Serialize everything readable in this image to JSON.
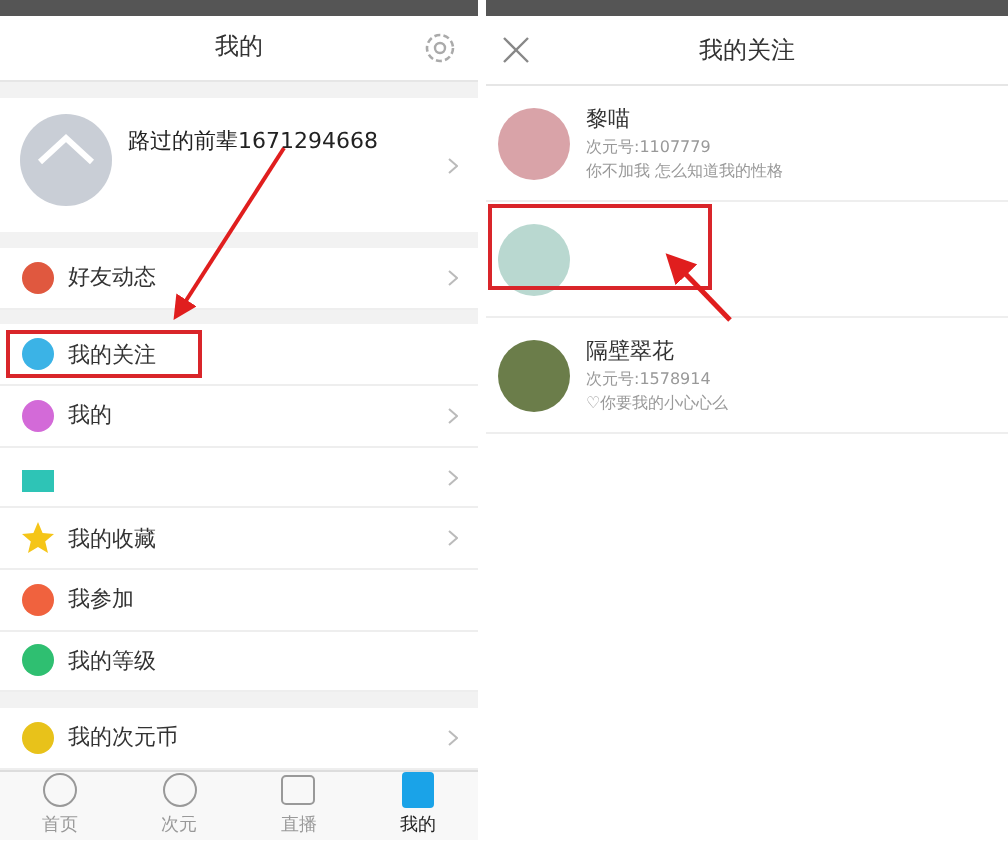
{
  "left_screen": {
    "title": "我的",
    "profile": {
      "name": "路过的前辈1671294668"
    },
    "menu_groups": [
      [
        {
          "label": "好友动态",
          "kind": "news",
          "highlighted": false,
          "chevron": true
        }
      ],
      [
        {
          "label": "我的关注",
          "kind": "follow",
          "highlighted": true,
          "chevron": false
        },
        {
          "label": "我的",
          "kind": "fans",
          "highlighted": false,
          "chevron": true
        },
        {
          "kind": "chart",
          "highlighted": false,
          "chevron": true
        },
        {
          "label": "我的收藏",
          "kind": "star",
          "highlighted": false,
          "chevron": true
        },
        {
          "label": "我参加",
          "kind": "party",
          "highlighted": false,
          "chevron": false
        },
        {
          "label": "我的等级",
          "kind": "level",
          "highlighted": false,
          "chevron": false
        }
      ],
      [
        {
          "label": "我的次元币",
          "kind": "coin",
          "highlighted": false,
          "chevron": true
        }
      ]
    ],
    "tabs": [
      {
        "label": "首页",
        "kind": "compass",
        "selected": false
      },
      {
        "label": "次元",
        "kind": "face",
        "selected": false
      },
      {
        "label": "直播",
        "kind": "video",
        "selected": false
      },
      {
        "label": "我的",
        "kind": "list",
        "selected": true
      }
    ]
  },
  "right_screen": {
    "title": "我的关注",
    "follows": [
      {
        "name": "黎喵",
        "id": "次元号:1107779",
        "bio": "你不加我 怎么知道我的性格",
        "highlighted": false
      },
      {
        "highlighted": true
      },
      {
        "name": "隔壁翠花",
        "id": "次元号:1578914",
        "bio": "♡你要我的小心心么",
        "highlighted": false
      }
    ]
  }
}
